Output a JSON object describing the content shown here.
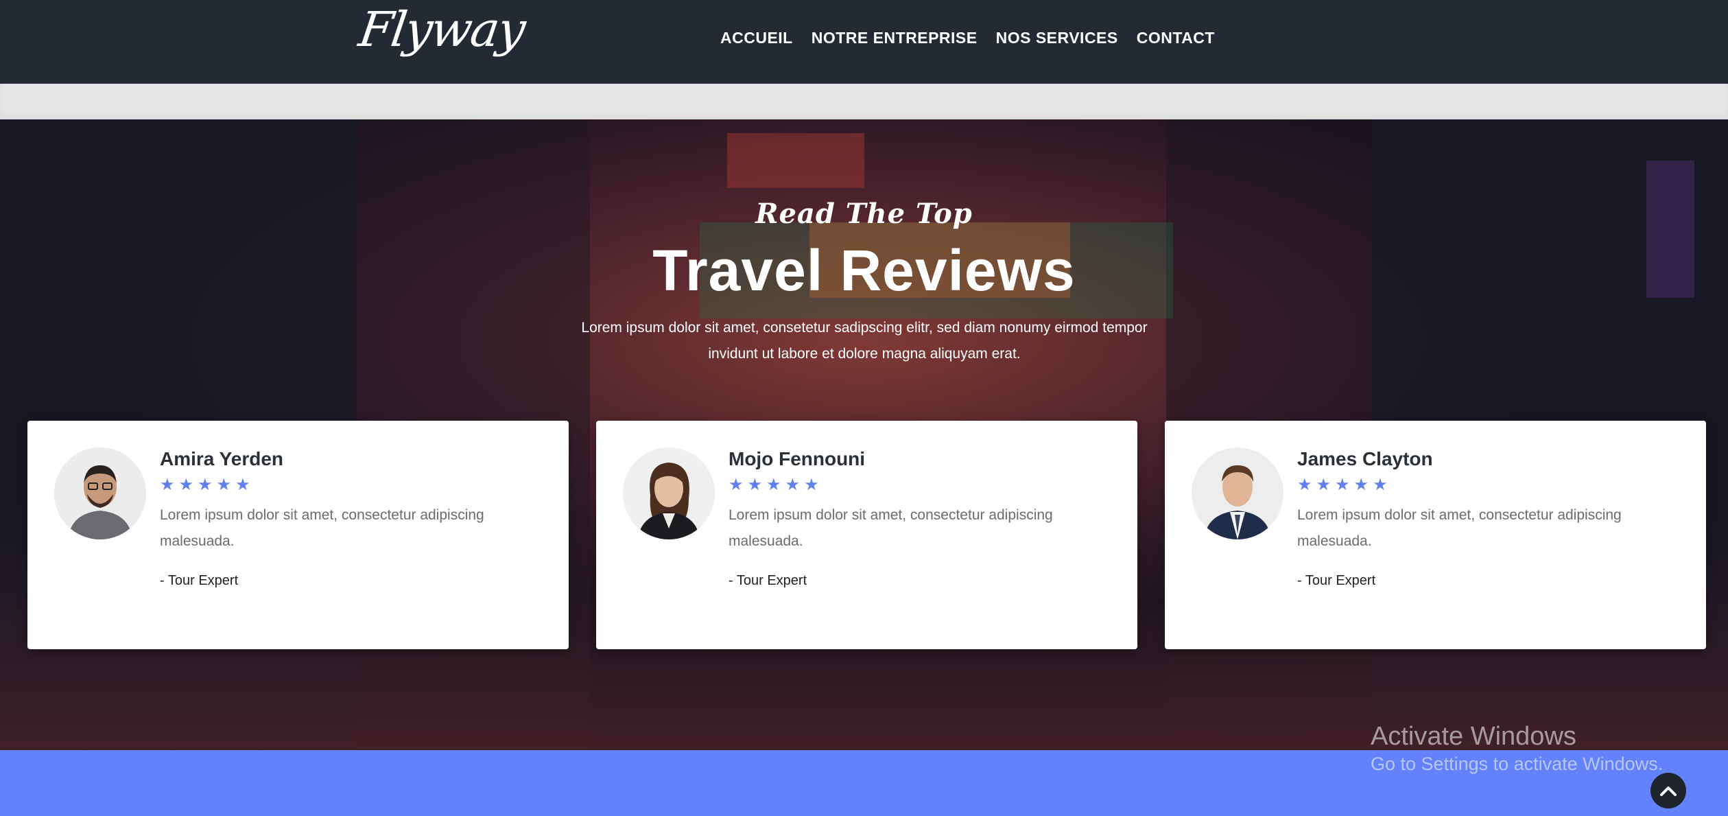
{
  "header": {
    "logo": "Flyway",
    "nav": [
      {
        "label": "ACCUEIL"
      },
      {
        "label": "NOTRE ENTREPRISE"
      },
      {
        "label": "NOS SERVICES"
      },
      {
        "label": "CONTACT"
      }
    ]
  },
  "hero": {
    "kicker": "Read The Top",
    "title": "Travel Reviews",
    "description": "Lorem ipsum dolor sit amet, consetetur sadipscing elitr, sed diam nonumy eirmod tempor invidunt ut labore et dolore magna aliquyam erat."
  },
  "reviews": [
    {
      "name": "Amira Yerden",
      "rating": 5,
      "text": "Lorem ipsum dolor sit amet, consectetur adipiscing malesuada.",
      "role": "- Tour Expert"
    },
    {
      "name": "Mojo Fennouni",
      "rating": 5,
      "text": "Lorem ipsum dolor sit amet, consectetur adipiscing malesuada.",
      "role": "- Tour Expert"
    },
    {
      "name": "James Clayton",
      "rating": 5,
      "text": "Lorem ipsum dolor sit amet, consectetur adipiscing malesuada.",
      "role": "- Tour Expert"
    }
  ],
  "watermark": {
    "title": "Activate Windows",
    "subtitle": "Go to Settings to activate Windows."
  },
  "icons": {
    "star": "star-icon",
    "scroll_top": "chevron-up-icon"
  },
  "colors": {
    "header_bg": "#242a33",
    "accent": "#6381fa",
    "star": "#6080ee"
  }
}
